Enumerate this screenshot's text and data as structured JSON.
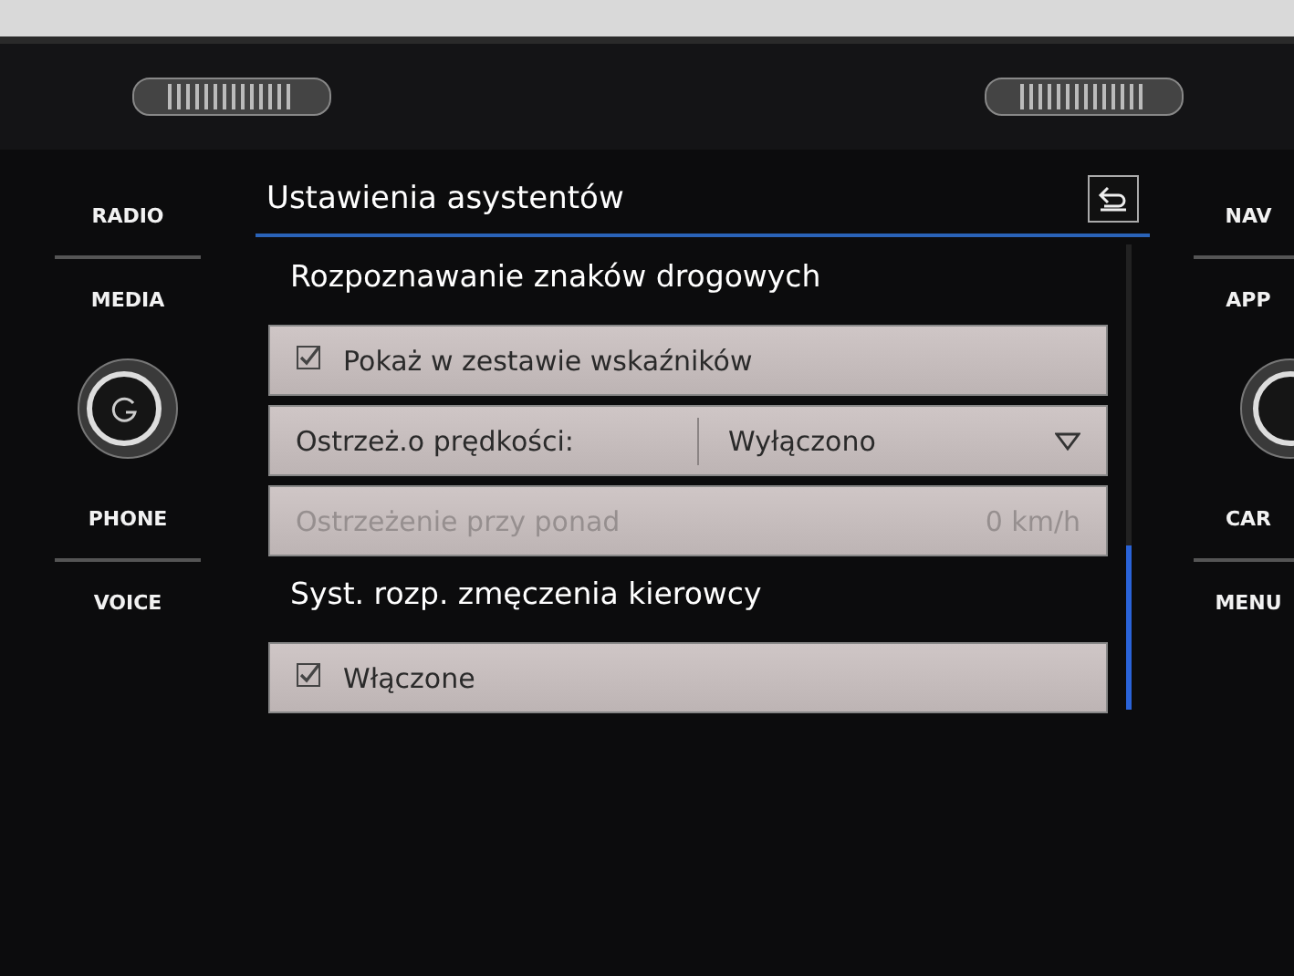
{
  "left_buttons": [
    {
      "label": "RADIO"
    },
    {
      "label": "MEDIA"
    },
    {
      "label": "PHONE"
    },
    {
      "label": "VOICE"
    }
  ],
  "right_buttons": [
    {
      "label": "NAV"
    },
    {
      "label": "APP"
    },
    {
      "label": "CAR"
    },
    {
      "label": "MENU"
    }
  ],
  "screen": {
    "title": "Ustawienia asystentów",
    "items": [
      {
        "kind": "header",
        "label": "Rozpoznawanie znaków drogowych"
      },
      {
        "kind": "checkbox",
        "label": "Pokaż w zestawie wskaźników",
        "checked": true,
        "disabled": false
      },
      {
        "kind": "dropdown",
        "label": "Ostrzeż.o prędkości:",
        "value": "Wyłączono",
        "disabled": false
      },
      {
        "kind": "value",
        "label": "Ostrzeżenie przy ponad",
        "value": "0 km/h",
        "disabled": true
      },
      {
        "kind": "header",
        "label": "Syst. rozp. zmęczenia kierowcy"
      },
      {
        "kind": "checkbox",
        "label": "Włączone",
        "checked": true,
        "disabled": false
      }
    ]
  }
}
